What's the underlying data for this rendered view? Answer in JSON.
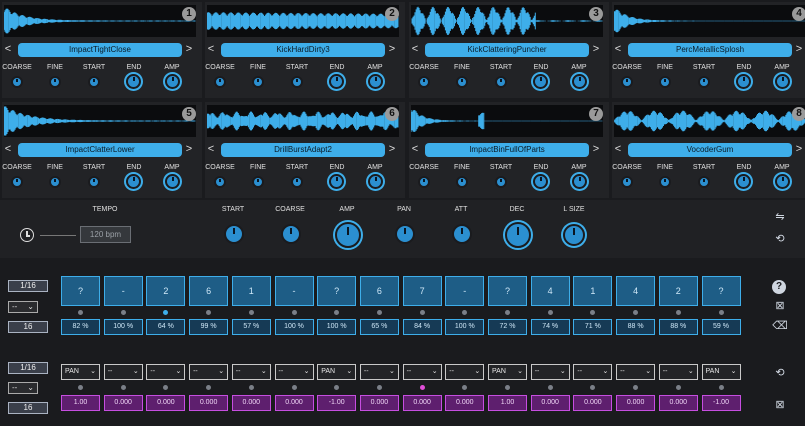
{
  "pads": [
    {
      "number": "1",
      "name": "ImpactTightClose"
    },
    {
      "number": "2",
      "name": "KickHardDirty3"
    },
    {
      "number": "3",
      "name": "KickClatteringPuncher"
    },
    {
      "number": "4",
      "name": "PercMetallicSplosh"
    },
    {
      "number": "5",
      "name": "ImpactClatterLower"
    },
    {
      "number": "6",
      "name": "DrillBurstAdapt2"
    },
    {
      "number": "7",
      "name": "ImpactBinFullOfParts"
    },
    {
      "number": "8",
      "name": "VocoderGum"
    }
  ],
  "pad_labels": {
    "coarse": "COARSE",
    "fine": "FINE",
    "start": "START",
    "end": "END",
    "amp": "AMP",
    "prev": "<",
    "next": ">"
  },
  "master": {
    "tempo_label": "TEMPO",
    "tempo_value": "120 bpm",
    "start": "START",
    "coarse": "COARSE",
    "amp": "AMP",
    "pan": "PAN",
    "att": "ATT",
    "dec": "DEC",
    "lsize": "L SIZE"
  },
  "seq1": {
    "rate": "1/16",
    "mode": "--",
    "length": "16",
    "steps": [
      "?",
      "-",
      "2",
      "6",
      "1",
      "-",
      "?",
      "6",
      "7",
      "-",
      "?",
      "4",
      "1",
      "4",
      "2",
      "?"
    ],
    "active_dot": 2,
    "percents": [
      "82 %",
      "100 %",
      "64 %",
      "99 %",
      "57 %",
      "100 %",
      "100 %",
      "65 %",
      "84 %",
      "100 %",
      "72 %",
      "74 %",
      "71 %",
      "88 %",
      "88 %",
      "59 %"
    ]
  },
  "seq2": {
    "rate": "1/16",
    "mode": "--",
    "length": "16",
    "targets": [
      "PAN",
      "--",
      "--",
      "--",
      "--",
      "--",
      "PAN",
      "--",
      "--",
      "--",
      "PAN",
      "--",
      "--",
      "--",
      "--",
      "PAN"
    ],
    "active_dot": 8,
    "values": [
      "1.00",
      "0.000",
      "0.000",
      "0.000",
      "0.000",
      "0.000",
      "-1.00",
      "0.000",
      "0.000",
      "0.000",
      "1.00",
      "0.000",
      "0.000",
      "0.000",
      "0.000",
      "-1.00"
    ]
  },
  "icons": {
    "help": "?",
    "shuffle": "⇋",
    "loop": "⟲",
    "clear": "⊠",
    "delete": "⌫"
  },
  "colors": {
    "accent": "#3eaeea",
    "magenta": "#c64ee0",
    "panel": "#222326"
  }
}
